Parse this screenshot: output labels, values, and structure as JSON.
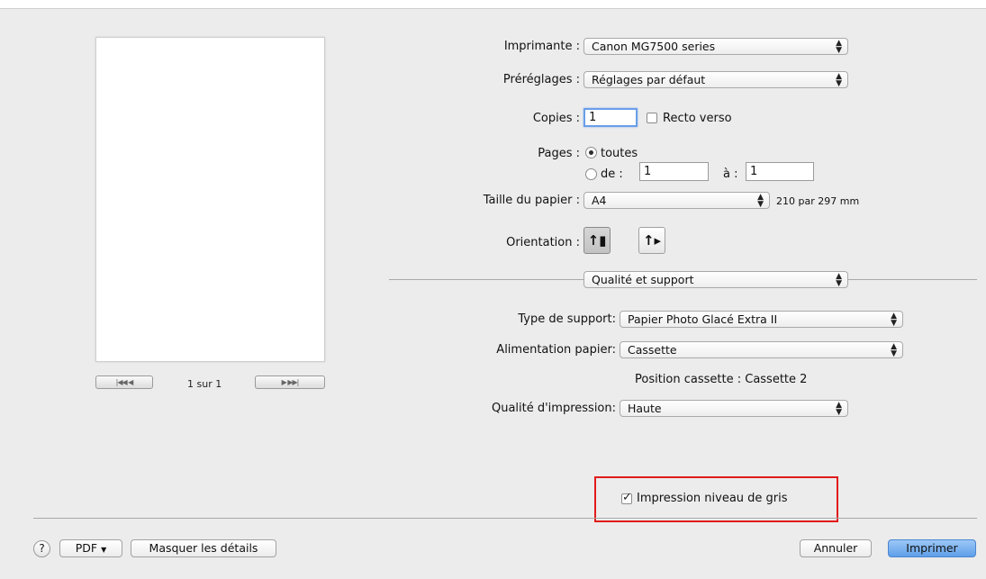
{
  "printer": {
    "label": "Imprimante :",
    "value": "Canon MG7500 series"
  },
  "presets": {
    "label": "Préréglages :",
    "value": "Réglages par défaut"
  },
  "copies": {
    "label": "Copies :",
    "value": "1",
    "duplex_label": "Recto verso",
    "duplex_checked": false
  },
  "pages": {
    "label": "Pages :",
    "all_label": "toutes",
    "from_label": "de :",
    "from_value": "1",
    "to_label": "à :",
    "to_value": "1",
    "selected": "all"
  },
  "paper_size": {
    "label": "Taille du papier :",
    "value": "A4",
    "dimensions": "210 par 297 mm"
  },
  "orientation": {
    "label": "Orientation :",
    "selected": "portrait"
  },
  "section": {
    "value": "Qualité et support"
  },
  "media_type": {
    "label": "Type de support:",
    "value": "Papier Photo Glacé Extra II"
  },
  "paper_source": {
    "label": "Alimentation papier:",
    "value": "Cassette"
  },
  "cassette_position": "Position cassette : Cassette 2",
  "print_quality": {
    "label": "Qualité d'impression:",
    "value": "Haute"
  },
  "grayscale": {
    "label": "Impression niveau de gris",
    "checked": true
  },
  "preview_nav": {
    "page_label": "1 sur 1",
    "first_prev": "|◀◀  ◀",
    "next_last": "▶  ▶▶|"
  },
  "footer": {
    "help": "?",
    "pdf": "PDF",
    "hide_details": "Masquer les détails",
    "cancel": "Annuler",
    "print": "Imprimer"
  },
  "colors": {
    "highlight_box": "#e21b1b",
    "primary_button": "#5f9fe9"
  }
}
